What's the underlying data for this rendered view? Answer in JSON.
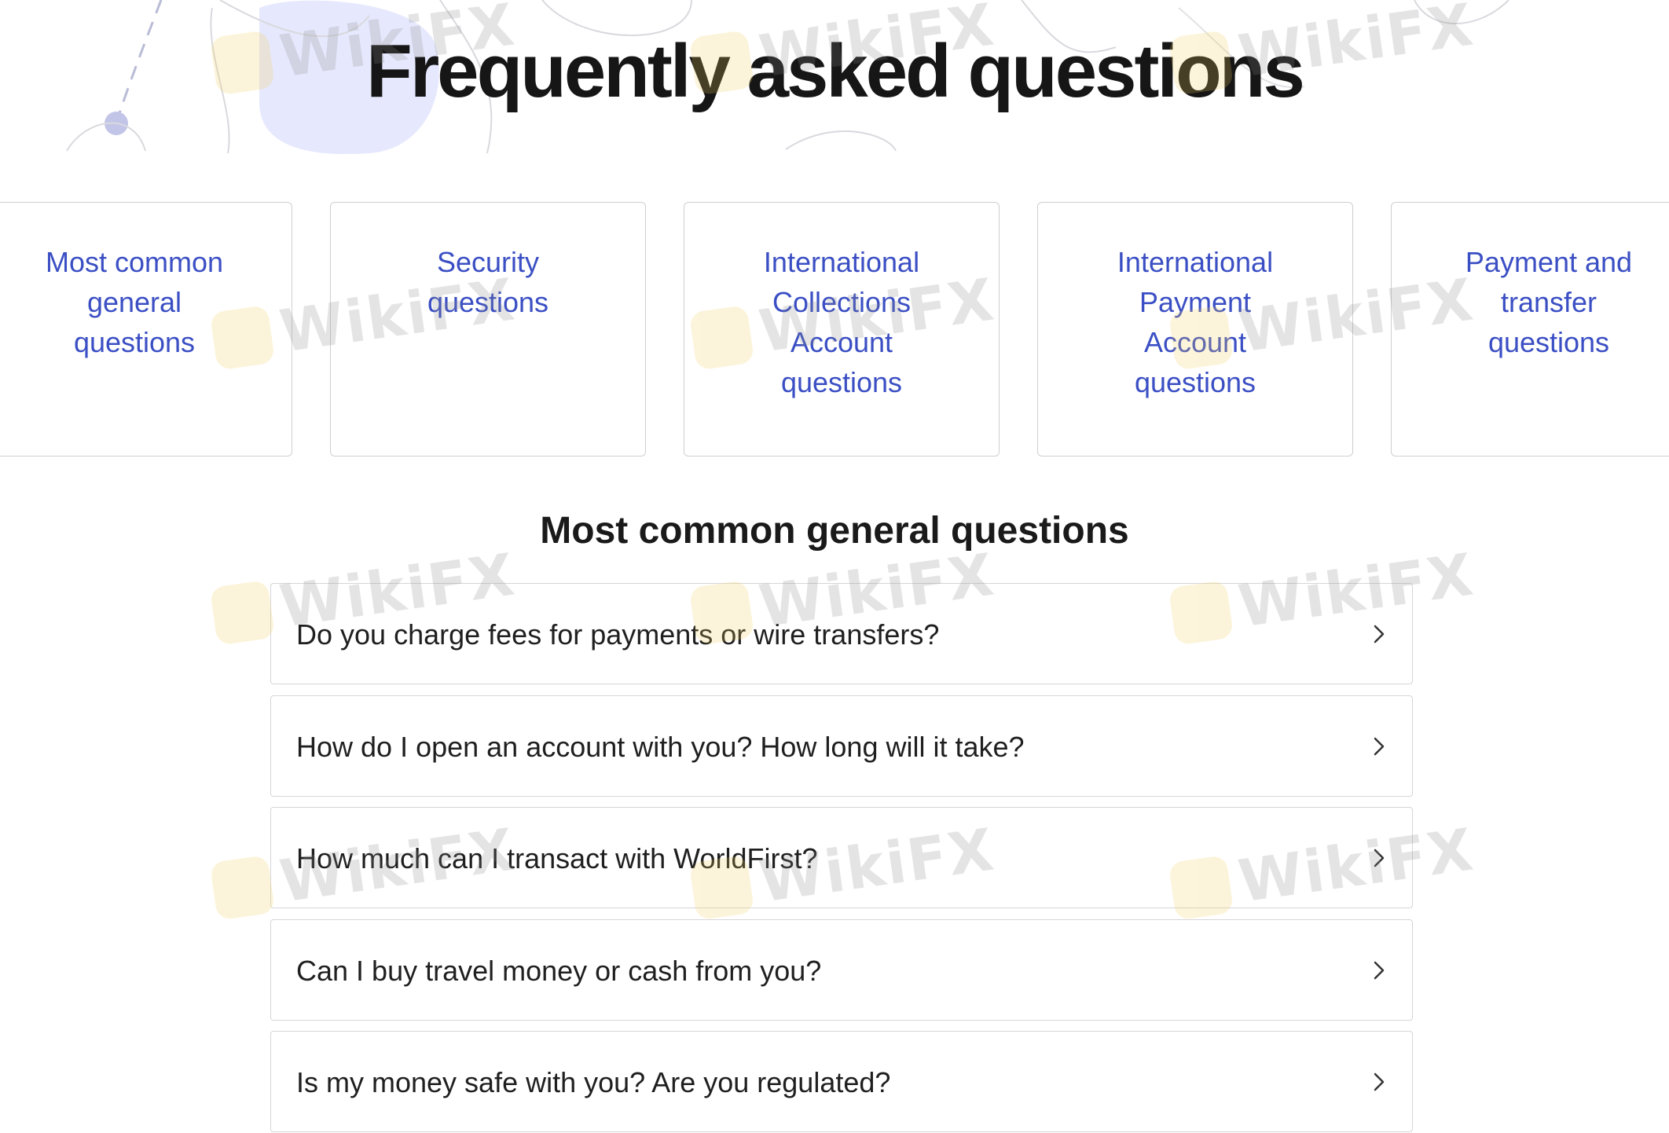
{
  "page": {
    "title": "Frequently asked questions",
    "section_title": "Most common general questions"
  },
  "categories": [
    {
      "label": "Most common general questions"
    },
    {
      "label": "Security questions"
    },
    {
      "label": "International Collections Account questions"
    },
    {
      "label": "International Payment Account questions"
    },
    {
      "label": "Payment and transfer questions"
    }
  ],
  "faq": [
    {
      "question": "Do you charge fees for payments or wire transfers?"
    },
    {
      "question": "How do I open an account with you? How long will it take?"
    },
    {
      "question": "How much can I transact with WorldFirst?"
    },
    {
      "question": "Can I buy travel money or cash from you?"
    },
    {
      "question": "Is my money safe with you? Are you regulated?"
    }
  ],
  "watermark": {
    "text": "WikiFX"
  },
  "colors": {
    "link_blue": "#3b4fc4",
    "card_border": "#cfcfd4",
    "title": "#161616",
    "decor_blob": "#e6e8fd",
    "decor_dot": "#c3c5e8"
  },
  "icons": {
    "faq_chevron": "chevron-right-icon",
    "watermark_logo": "wikifx-logo-icon"
  }
}
